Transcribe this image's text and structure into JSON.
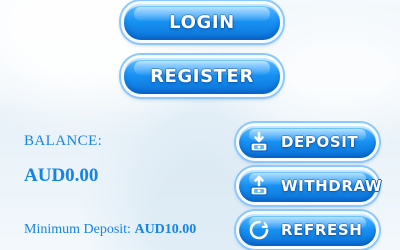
{
  "auth": {
    "login_label": "LOGIN",
    "register_label": "REGISTER"
  },
  "wallet": {
    "balance_label": "BALANCE:",
    "balance_value": "AUD0.00",
    "minimum_deposit_label": "Minimum Deposit:",
    "minimum_deposit_value": "AUD10.00"
  },
  "actions": {
    "deposit_label": "DEPOSIT",
    "withdraw_label": "WITHDRAW",
    "refresh_label": "REFRESH"
  },
  "icons": {
    "deposit": "deposit-icon",
    "withdraw": "withdraw-icon",
    "refresh": "refresh-icon"
  },
  "colors": {
    "button_blue": "#1792f3",
    "button_blue_dark": "#0c72d8",
    "text_blue": "#1683e7",
    "background": "#f4f9fd"
  }
}
